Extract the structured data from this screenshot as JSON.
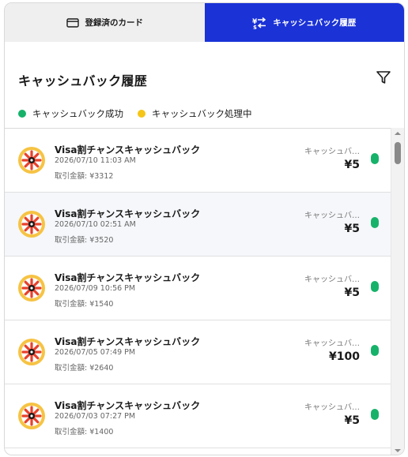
{
  "tabs": {
    "cards_label": "登録済のカード",
    "cards_icon": "credit-card-icon",
    "history_label": "キャッシュバック履歴",
    "history_icon": "exchange-arrows-icon"
  },
  "header": {
    "title": "キャッシュバック履歴",
    "filter_icon": "filter-icon"
  },
  "legend": {
    "success_label": "キャッシュバック成功",
    "success_color": "#17b26a",
    "processing_label": "キャッシュバック処理中",
    "processing_color": "#f5c518"
  },
  "transactions": [
    {
      "name": "Visa割チャンスキャッシュバック",
      "date": "2026/07/10 11:03 AM",
      "amount": "取引金額: ¥3312",
      "status": "キャッシュバ…",
      "value": "¥5",
      "state": "success"
    },
    {
      "name": "Visa割チャンスキャッシュバック",
      "date": "2026/07/10 02:51 AM",
      "amount": "取引金額: ¥3520",
      "status": "キャッシュバ…",
      "value": "¥5",
      "state": "success"
    },
    {
      "name": "Visa割チャンスキャッシュバック",
      "date": "2026/07/09 10:56 PM",
      "amount": "取引金額: ¥1540",
      "status": "キャッシュバ…",
      "value": "¥5",
      "state": "success"
    },
    {
      "name": "Visa割チャンスキャッシュバック",
      "date": "2026/07/05 07:49 PM",
      "amount": "取引金額: ¥2640",
      "status": "キャッシュバ…",
      "value": "¥100",
      "state": "success"
    },
    {
      "name": "Visa割チャンスキャッシュバック",
      "date": "2026/07/03 07:27 PM",
      "amount": "取引金額: ¥1400",
      "status": "キャッシュバ…",
      "value": "¥5",
      "state": "success"
    }
  ]
}
